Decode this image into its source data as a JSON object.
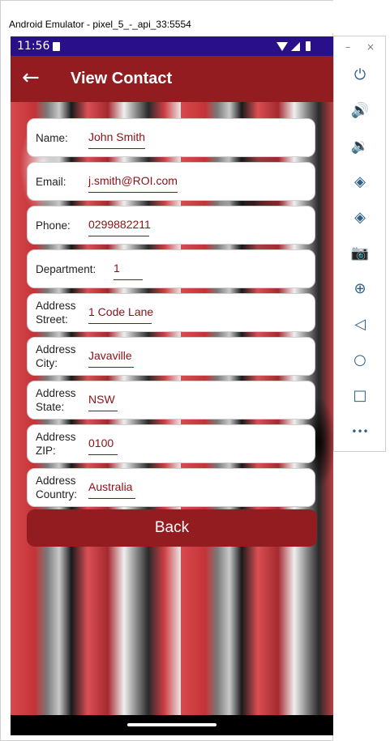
{
  "window": {
    "title": "Android Emulator - pixel_5_-_api_33:5554"
  },
  "status_bar": {
    "time": "11:56"
  },
  "app_bar": {
    "title": "View Contact"
  },
  "fields": [
    {
      "label": "Name:",
      "value": "John Smith"
    },
    {
      "label": "Email:",
      "value": "j.smith@ROI.com"
    },
    {
      "label": "Phone:",
      "value": "0299882211"
    },
    {
      "label": "Department:",
      "value": "1"
    },
    {
      "label": "Address Street:",
      "value": "1 Code Lane"
    },
    {
      "label": "Address City:",
      "value": "Javaville"
    },
    {
      "label": "Address State:",
      "value": "NSW"
    },
    {
      "label": "Address ZIP:",
      "value": "0100"
    },
    {
      "label": "Address Country:",
      "value": "Australia"
    }
  ],
  "back_button": {
    "label": "Back"
  },
  "toolbar": {
    "minimize": "–",
    "close": "×",
    "tools": [
      {
        "icon": "power-icon",
        "glyph": "⏻"
      },
      {
        "icon": "volume-up-icon",
        "glyph": "🔊"
      },
      {
        "icon": "volume-down-icon",
        "glyph": "🔉"
      },
      {
        "icon": "rotate-left-icon",
        "glyph": "◈"
      },
      {
        "icon": "rotate-right-icon",
        "glyph": "◈"
      },
      {
        "icon": "camera-icon",
        "glyph": "📷"
      },
      {
        "icon": "zoom-icon",
        "glyph": "⊕"
      },
      {
        "icon": "back-icon",
        "glyph": "◁"
      },
      {
        "icon": "home-icon",
        "glyph": "○"
      },
      {
        "icon": "overview-icon",
        "glyph": "□"
      },
      {
        "icon": "more-icon",
        "glyph": "•••"
      }
    ]
  },
  "colors": {
    "app_bar": "#931c20",
    "status_bar": "#2a0f8a",
    "value_text": "#8b1116",
    "toolbar_icon": "#2f5f88"
  }
}
